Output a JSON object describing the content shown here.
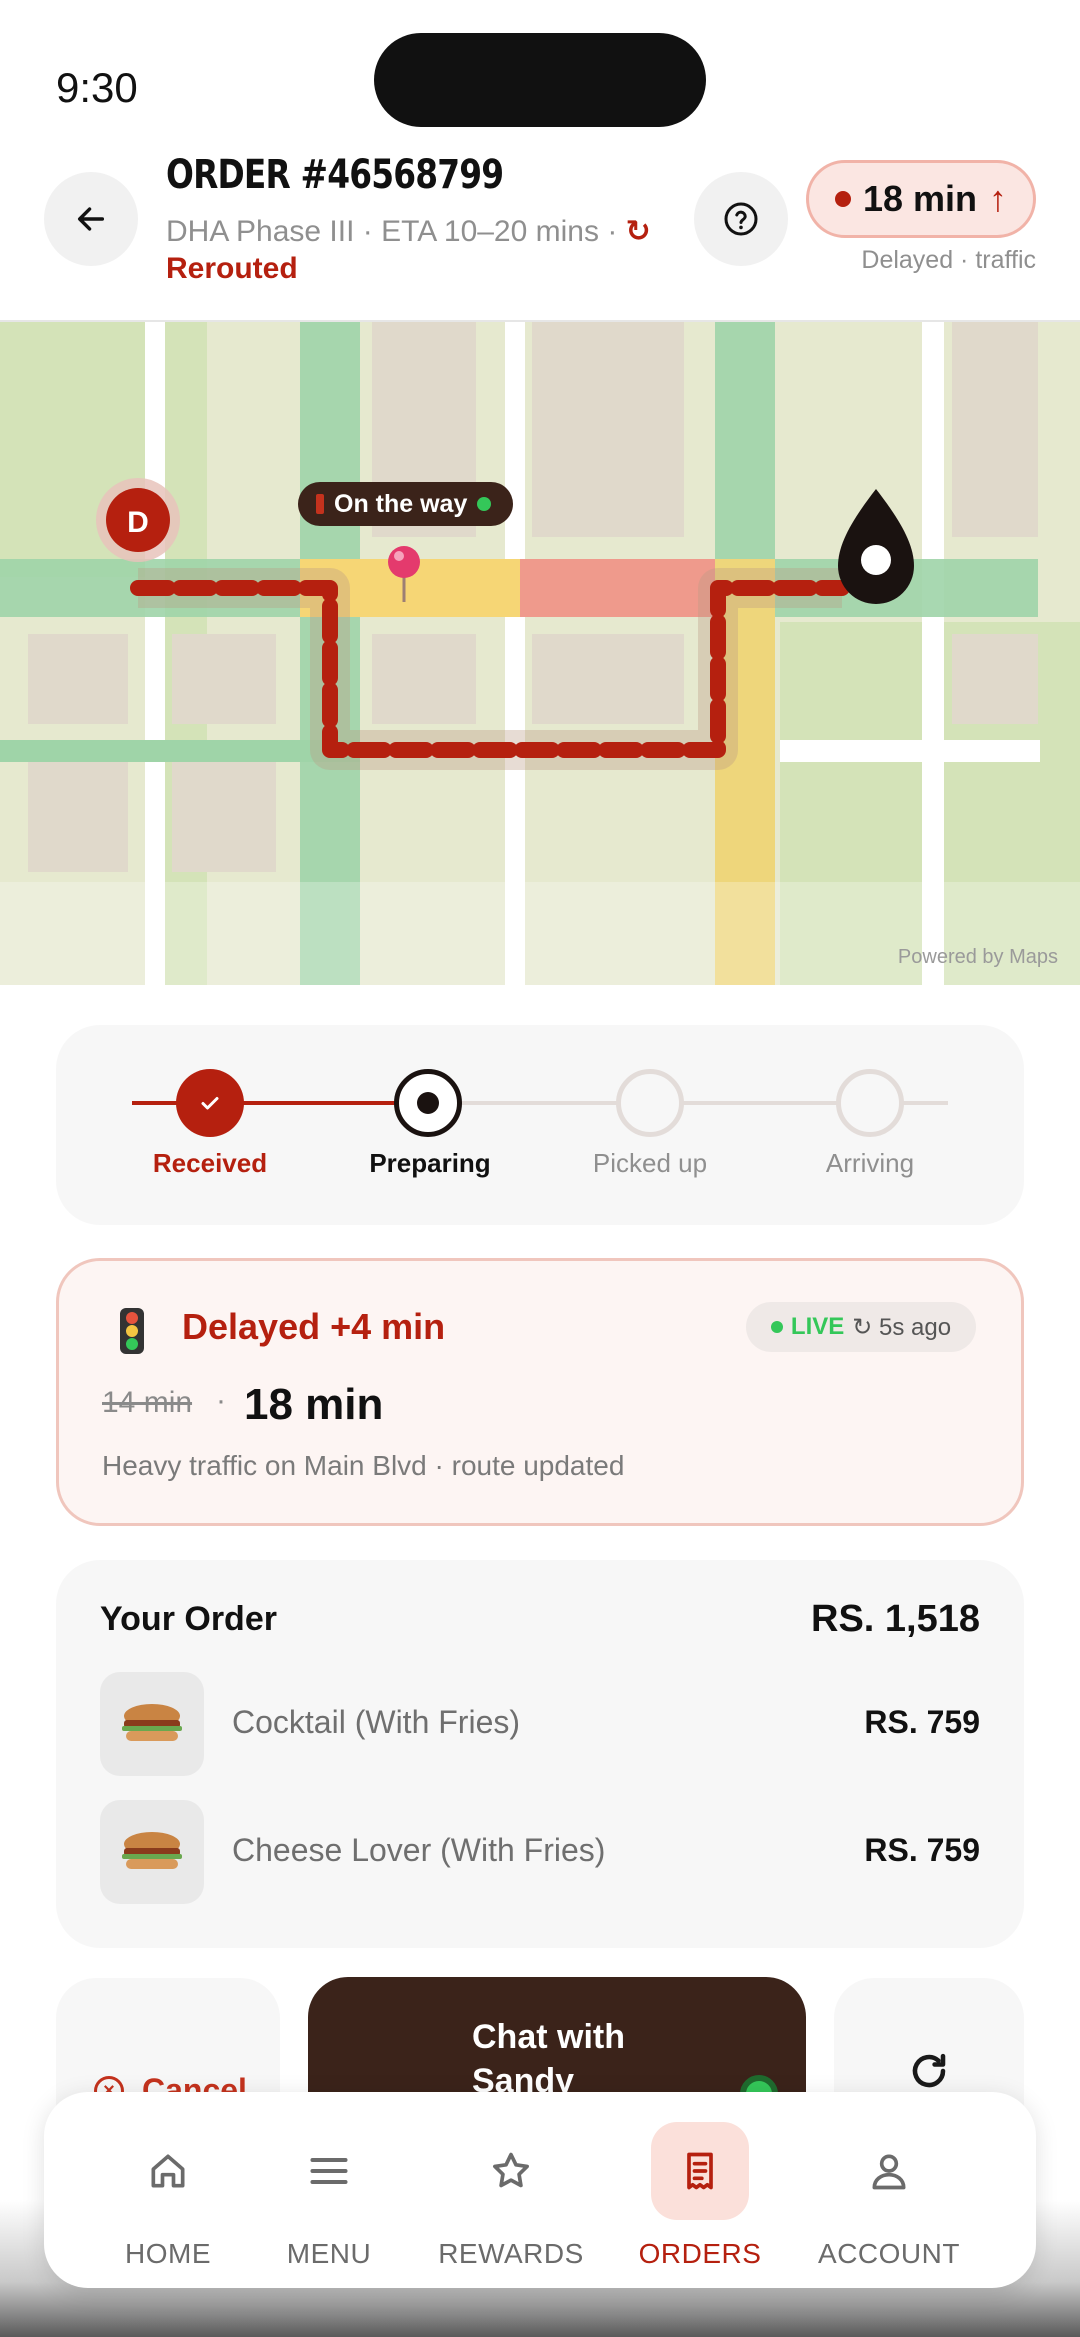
{
  "status_bar": {
    "time": "9:30"
  },
  "header": {
    "order_title": "ORDER #46568799",
    "subtitle": "DHA Phase III · ETA 10–20 mins ·",
    "reroute_icon": "↻",
    "rerouted_label": "Rerouted",
    "eta_value": "18 min",
    "eta_trend_icon": "↑",
    "eta_note": "Delayed · traffic"
  },
  "map": {
    "driver_marker": "D",
    "status_chip": "On the way",
    "attribution": "Powered by Maps"
  },
  "progress": {
    "steps": [
      {
        "label": "Received",
        "state": "done"
      },
      {
        "label": "Preparing",
        "state": "current"
      },
      {
        "label": "Picked up",
        "state": "pending"
      },
      {
        "label": "Arriving",
        "state": "pending"
      }
    ]
  },
  "delay": {
    "title": "Delayed +4 min",
    "live_label": "LIVE",
    "updated": "↻ 5s ago",
    "old_time": "14 min",
    "separator": "·",
    "new_time": "18 min",
    "description": "Heavy traffic on Main Blvd · route updated"
  },
  "order": {
    "heading": "Your Order",
    "total": "RS. 1,518",
    "items": [
      {
        "name": "Cocktail (With Fries)",
        "price": "RS. 759"
      },
      {
        "name": "Cheese Lover (With Fries)",
        "price": "RS. 759"
      }
    ]
  },
  "actions": {
    "cancel_label": "Cancel",
    "chat_label": "Chat with Sandy"
  },
  "nav": {
    "items": [
      {
        "label": "HOME",
        "icon": "home-icon"
      },
      {
        "label": "MENU",
        "icon": "menu-icon"
      },
      {
        "label": "REWARDS",
        "icon": "star-icon"
      },
      {
        "label": "ORDERS",
        "icon": "receipt-icon",
        "active": true
      },
      {
        "label": "ACCOUNT",
        "icon": "user-icon"
      }
    ]
  },
  "colors": {
    "brand_red": "#b5200f",
    "dark_brown": "#3b231a",
    "live_green": "#34c759",
    "delay_bg": "#fdf5f3"
  }
}
